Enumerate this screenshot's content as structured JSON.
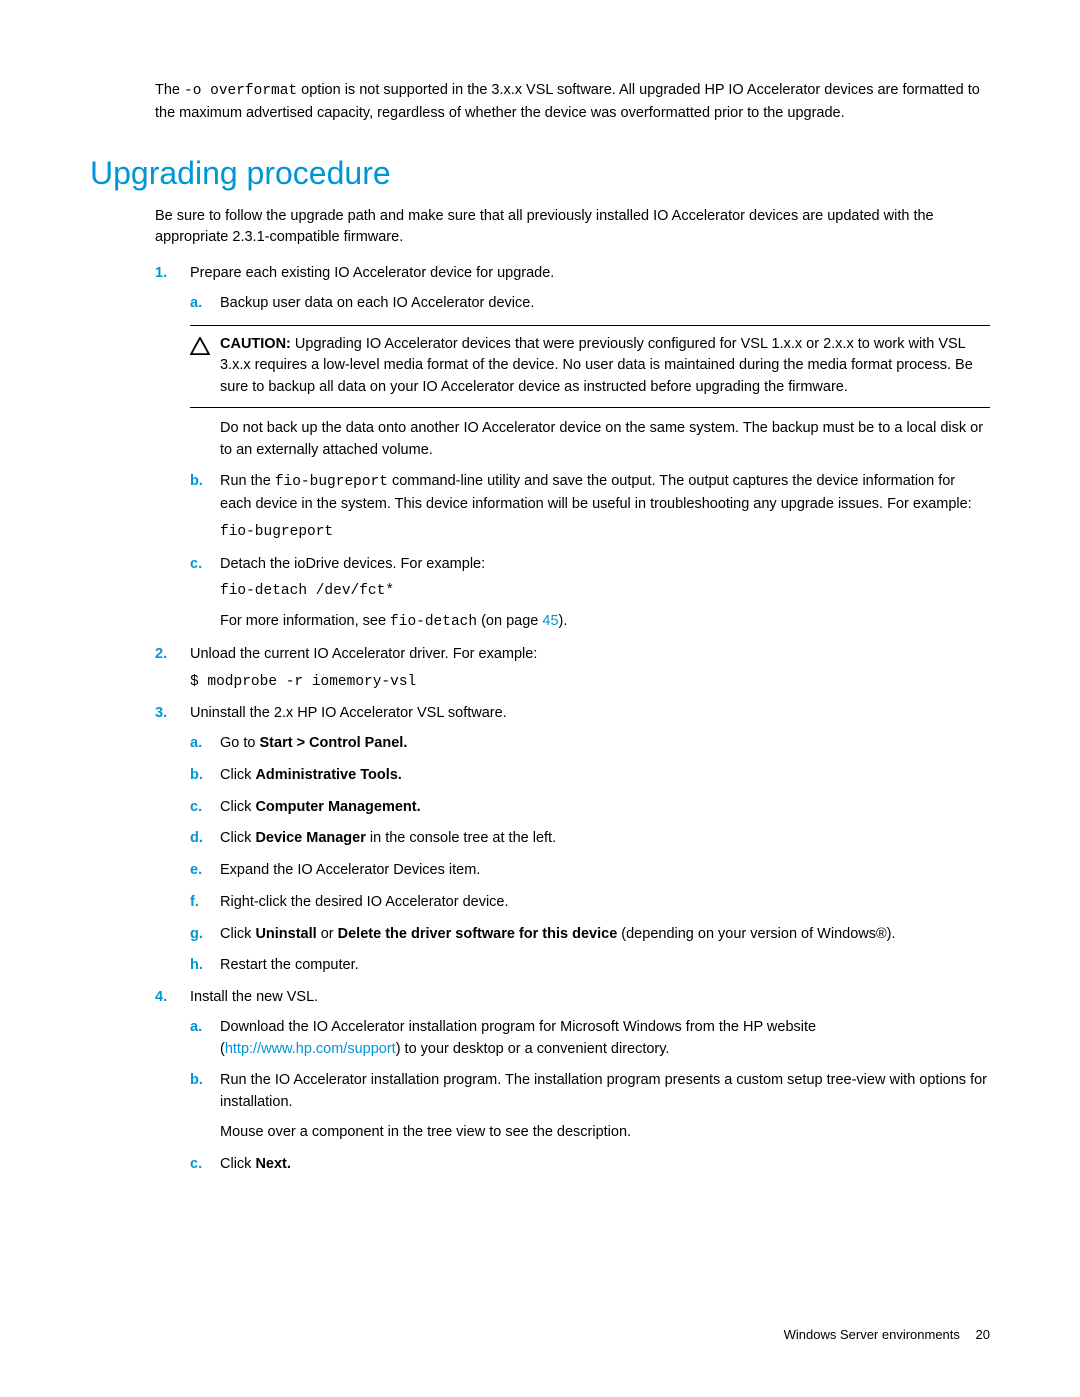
{
  "intro": {
    "pre": "The ",
    "code": "-o overformat",
    "post": " option is not supported in the 3.x.x VSL software. All upgraded HP IO Accelerator devices are formatted to the maximum advertised capacity, regardless of whether the device was overformatted prior to the upgrade."
  },
  "heading": "Upgrading procedure",
  "section_intro": "Be sure to follow the upgrade path and make sure that all previously installed IO Accelerator devices are updated with the appropriate 2.3.1-compatible firmware.",
  "steps": {
    "s1": {
      "num": "1.",
      "text": "Prepare each existing IO Accelerator device for upgrade.",
      "a": {
        "letter": "a.",
        "text": "Backup user data on each IO Accelerator device."
      },
      "caution": {
        "label": "CAUTION:",
        "text": " Upgrading IO Accelerator devices that were previously configured for VSL 1.x.x or 2.x.x to work with VSL 3.x.x requires a low-level media format of the device. No user data is maintained during the media format process. Be sure to backup all data on your IO Accelerator device as instructed before upgrading the firmware."
      },
      "post_caution": "Do not back up the data onto another IO Accelerator device on the same system. The backup must be to a local disk or to an externally attached volume.",
      "b": {
        "letter": "b.",
        "pre": "Run the ",
        "code": "fio-bugreport",
        "post": " command-line utility and save the output. The output captures the device information for each device in the system. This device information will be useful in troubleshooting any upgrade issues. For example:",
        "example": "fio-bugreport"
      },
      "c": {
        "letter": "c.",
        "text": "Detach the ioDrive devices. For example:",
        "example": "fio-detach /dev/fct*",
        "more_pre": "For more information, see ",
        "more_code": "fio-detach",
        "more_mid": " (on page ",
        "more_link": "45",
        "more_post": ")."
      }
    },
    "s2": {
      "num": "2.",
      "text": "Unload the current IO Accelerator driver. For example:",
      "example": "$ modprobe -r iomemory-vsl"
    },
    "s3": {
      "num": "3.",
      "text": "Uninstall the 2.x HP IO Accelerator VSL software.",
      "a": {
        "letter": "a.",
        "pre": "Go to ",
        "bold": "Start > Control Panel."
      },
      "b": {
        "letter": "b.",
        "pre": "Click ",
        "bold": "Administrative Tools."
      },
      "c": {
        "letter": "c.",
        "pre": "Click ",
        "bold": "Computer Management."
      },
      "d": {
        "letter": "d.",
        "pre": "Click ",
        "bold": "Device Manager",
        "post": " in the console tree at the left."
      },
      "e": {
        "letter": "e.",
        "text": "Expand the IO Accelerator Devices item."
      },
      "f": {
        "letter": "f.",
        "text": "Right-click the desired IO Accelerator device."
      },
      "g": {
        "letter": "g.",
        "pre": "Click ",
        "bold1": "Uninstall",
        "mid": " or ",
        "bold2": "Delete the driver software for this device",
        "post": " (depending on your version of Windows®)."
      },
      "h": {
        "letter": "h.",
        "text": "Restart the computer."
      }
    },
    "s4": {
      "num": "4.",
      "text": "Install the new VSL.",
      "a": {
        "letter": "a.",
        "pre": "Download the IO Accelerator installation program for Microsoft Windows from the HP website (",
        "link": "http://www.hp.com/support",
        "post": ") to your desktop or a convenient directory."
      },
      "b": {
        "letter": "b.",
        "text": "Run the IO Accelerator installation program. The installation program presents a custom setup tree-view with options for installation.",
        "para2": "Mouse over a component in the tree view to see the description."
      },
      "c": {
        "letter": "c.",
        "pre": "Click ",
        "bold": "Next."
      }
    }
  },
  "footer": {
    "text": "Windows Server environments",
    "page": "20"
  }
}
